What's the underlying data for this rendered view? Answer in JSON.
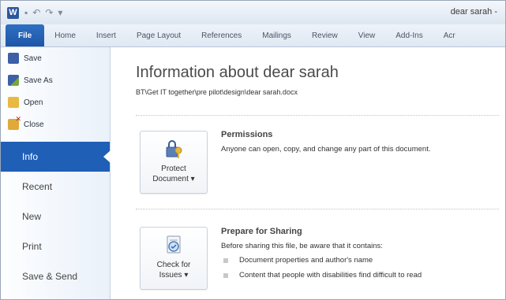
{
  "window": {
    "title": "dear sarah -",
    "app_letter": "W"
  },
  "qat": [
    {
      "name": "save-quick-icon",
      "glyph": "▪"
    },
    {
      "name": "undo-icon",
      "glyph": "↶"
    },
    {
      "name": "redo-icon",
      "glyph": "↷"
    },
    {
      "name": "customize-qat-icon",
      "glyph": "▾"
    }
  ],
  "tabs": [
    "File",
    "Home",
    "Insert",
    "Page Layout",
    "References",
    "Mailings",
    "Review",
    "View",
    "Add-Ins",
    "Acr"
  ],
  "backstage": {
    "commands": [
      {
        "label": "Save",
        "icon": "save-icon"
      },
      {
        "label": "Save As",
        "icon": "save-as-icon"
      },
      {
        "label": "Open",
        "icon": "open-folder-icon"
      },
      {
        "label": "Close",
        "icon": "close-folder-icon"
      }
    ],
    "nav": [
      "Info",
      "Recent",
      "New",
      "Print",
      "Save & Send"
    ],
    "active_nav": "Info"
  },
  "info": {
    "title": "Information about dear sarah",
    "path": "BT\\Get IT together\\pre pilot\\design\\dear sarah.docx",
    "permissions": {
      "button_line1": "Protect",
      "button_line2": "Document ▾",
      "heading": "Permissions",
      "text": "Anyone can open, copy, and change any part of this document."
    },
    "sharing": {
      "button_line1": "Check for",
      "button_line2": "Issues ▾",
      "heading": "Prepare for Sharing",
      "text": "Before sharing this file, be aware that it contains:",
      "bullets": [
        "Document properties and author's name",
        "Content that people with disabilities find difficult to read"
      ]
    }
  },
  "colors": {
    "accent": "#1f5fb6",
    "file_tab": "#2b6cc0"
  }
}
